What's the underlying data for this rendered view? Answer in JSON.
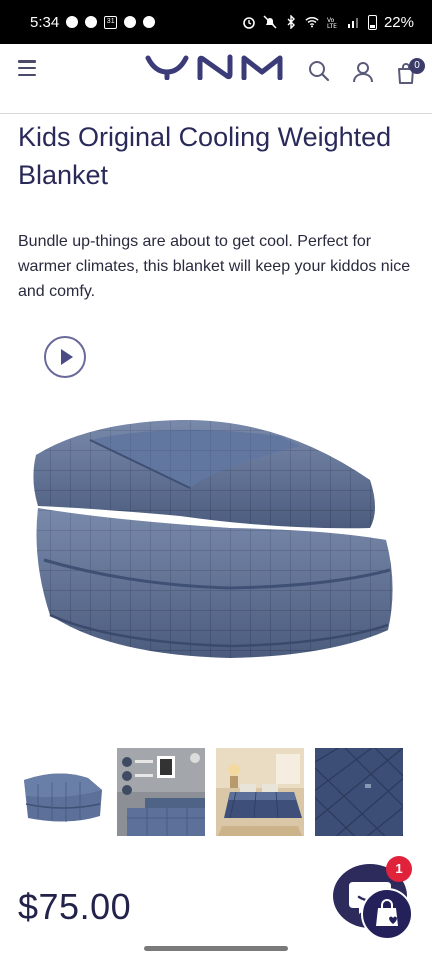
{
  "status_bar": {
    "time": "5:34",
    "battery": "22%",
    "calendar_day": "31"
  },
  "header": {
    "brand": "YNM",
    "cart_count": "0",
    "icons": [
      "menu-icon",
      "search-icon",
      "account-icon",
      "cart-icon"
    ]
  },
  "product": {
    "title": "Kids Original Cooling Weighted Blanket",
    "description": "Bundle up-things are about to get cool. Perfect for warmer climates, this blanket will keep your kiddos nice and comfy.",
    "price": "$75.00"
  },
  "gallery": {
    "thumbnails": [
      "folded-blanket",
      "product-infographic",
      "bedroom-scene",
      "fabric-closeup"
    ]
  },
  "chat": {
    "badge_count": "1"
  },
  "colors": {
    "brand": "#2d2a5c",
    "blanket": "#5b6f97",
    "badge": "#e0223b"
  }
}
